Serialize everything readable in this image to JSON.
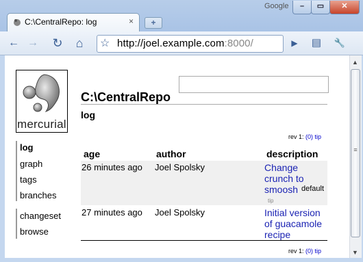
{
  "window": {
    "brand": "Google",
    "controls": [
      "–",
      "▭",
      "✕"
    ]
  },
  "tab": {
    "title": "C:\\CentralRepo: log",
    "close": "×",
    "new_tab": "+"
  },
  "toolbar": {
    "back": "←",
    "forward": "→",
    "reload": "↻",
    "home": "⌂",
    "star": "☆",
    "url_host": "http://joel.example.com",
    "url_port": ":8000/",
    "go": "▶",
    "page_menu": "▤",
    "tools_menu": "🔧"
  },
  "logo": {
    "text": "mercurial"
  },
  "nav": {
    "group1": [
      "log",
      "graph",
      "tags",
      "branches"
    ],
    "group2": [
      "changeset",
      "browse"
    ]
  },
  "search": {
    "value": ""
  },
  "repo_title": "C:\\CentralRepo",
  "page_title": "log",
  "revnav": {
    "prefix": "rev 1:",
    "count": "(0)",
    "tip": "tip"
  },
  "table": {
    "headers": [
      "age",
      "author",
      "description"
    ],
    "rows": [
      {
        "age": "26 minutes ago",
        "author": "Joel Spolsky",
        "description_lines": [
          "Change",
          "crunch to",
          "smoosh"
        ],
        "branch": "default",
        "tag": "tip"
      },
      {
        "age": "27 minutes ago",
        "author": "Joel Spolsky",
        "description_lines": [
          "Initial version",
          "of guacamole",
          "recipe"
        ]
      }
    ]
  },
  "colors": {
    "link": "#1b23b3",
    "chrome": "#c4d7ef",
    "row_highlight": "#f0f0f0"
  }
}
